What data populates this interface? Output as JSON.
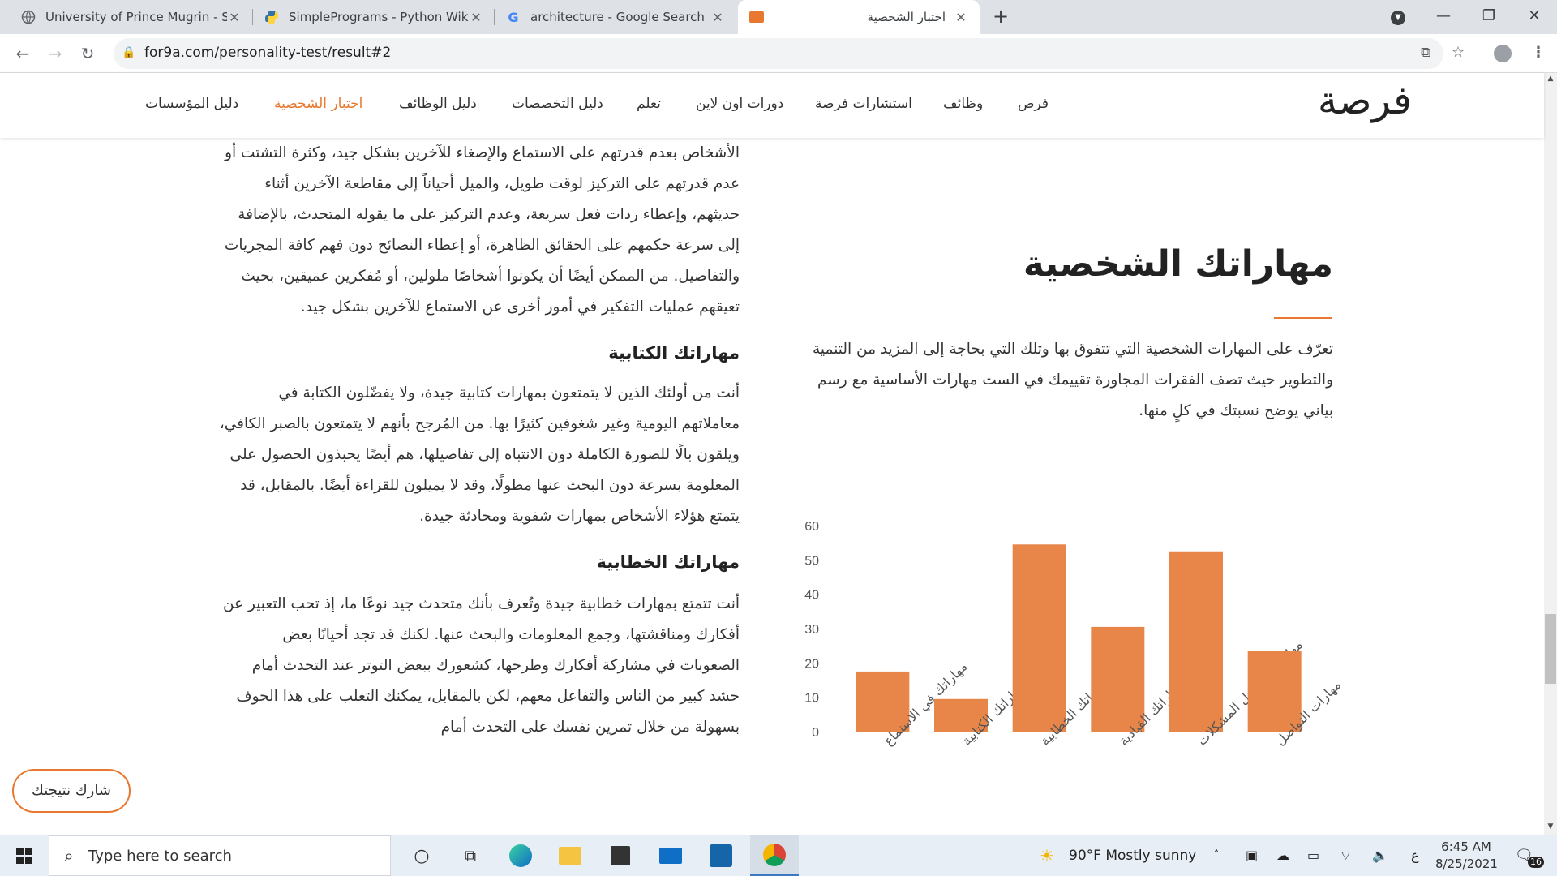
{
  "browser": {
    "tabs": [
      {
        "title": "University of Prince Mugrin - Stu",
        "icon": "globe-icon"
      },
      {
        "title": "SimplePrograms - Python Wiki",
        "icon": "python-icon"
      },
      {
        "title": "architecture - Google Search",
        "icon": "google-icon"
      },
      {
        "title": "اختبار الشخصية",
        "icon": "site-icon"
      }
    ],
    "url": "for9a.com/personality-test/result#2"
  },
  "site": {
    "logo": "فرصة",
    "menu": [
      "فرص",
      "وظائف",
      "استشارات فرصة",
      "دورات اون لاين",
      "تعلم",
      "دليل التخصصات",
      "دليل الوظائف",
      "اختبار الشخصية",
      "دليل المؤسسات"
    ],
    "active_menu": "اختبار الشخصية",
    "accent": "#e8782f"
  },
  "left": {
    "p1": "الأشخاص بعدم قدرتهم على الاستماع والإصغاء للآخرين بشكل جيد، وكثرة التشتت أو عدم قدرتهم على التركيز لوقت طويل، والميل أحياناً إلى مقاطعة الآخرين أثناء حديثهم، وإعطاء ردات فعل سريعة، وعدم التركيز على ما يقوله المتحدث، بالإضافة إلى سرعة حكمهم على الحقائق الظاهرة، أو إعطاء النصائح دون فهم كافة المجريات والتفاصيل. من الممكن أيضًا أن يكونوا أشخاصًا ملولين، أو مُفكرين عميقين، بحيث تعيقهم عمليات التفكير في أمور أخرى عن الاستماع للآخرين بشكل جيد.",
    "h_writing": "مهاراتك الكتابية",
    "p_writing": "أنت من أولئك الذين لا يتمتعون بمهارات كتابية جيدة، ولا يفضّلون الكتابة في معاملاتهم اليومية وغير شغوفين كثيرًا بها. من المُرجح بأنهم لا يتمتعون بالصبر الكافي، ويلقون بالًا للصورة الكاملة دون الانتباه إلى تفاصيلها، هم أيضًا يحبذون الحصول على المعلومة بسرعة دون البحث عنها مطولًا، وقد لا يميلون للقراءة أيضًا. بالمقابل، قد يتمتع هؤلاء الأشخاص بمهارات شفوية ومحادثة جيدة.",
    "h_speech": "مهاراتك الخطابية",
    "p_speech": "أنت تتمتع بمهارات خطابية جيدة وتُعرف بأنك متحدث جيد نوعًا ما، إذ تحب التعبير عن أفكارك ومناقشتها، وجمع المعلومات والبحث عنها. لكنك قد تجد أحيانًا بعض الصعوبات في مشاركة أفكارك وطرحها، كشعورك ببعض التوتر عند التحدث أمام حشد كبير من الناس والتفاعل معهم، لكن بالمقابل، يمكنك التغلب على هذا الخوف بسهولة من خلال تمرين نفسك على التحدث أمام"
  },
  "right": {
    "title": "مهاراتك الشخصية",
    "intro": "تعرّف على المهارات الشخصية التي تتفوق بها وتلك التي بحاجة إلى المزيد من التنمية والتطوير حيث تصف الفقرات المجاورة تقييمك في الست مهارات الأساسية مع رسم بياني يوضح نسبتك في كلٍ منها."
  },
  "chart_data": {
    "type": "bar",
    "categories": [
      "مهاراتك في الاستماع",
      "مهاراتك الكتابية",
      "مهاراتك الخطابية",
      "مهاراتك القيادية",
      "مهاراتك في حل المشكلات",
      "مهارات التواصل"
    ],
    "values": [
      17.5,
      9.5,
      54.5,
      30.5,
      52.5,
      23.5
    ],
    "ylim": [
      0,
      60
    ],
    "yticks": [
      0,
      10,
      20,
      30,
      40,
      50,
      60
    ],
    "color": "#e8864a",
    "grid": false
  },
  "share": {
    "label": "شارك نتيجتك"
  },
  "taskbar": {
    "search_placeholder": "Type here to search",
    "weather": "90°F  Mostly sunny",
    "lang": "ع",
    "time": "6:45 AM",
    "date": "8/25/2021",
    "notifications": "16"
  }
}
